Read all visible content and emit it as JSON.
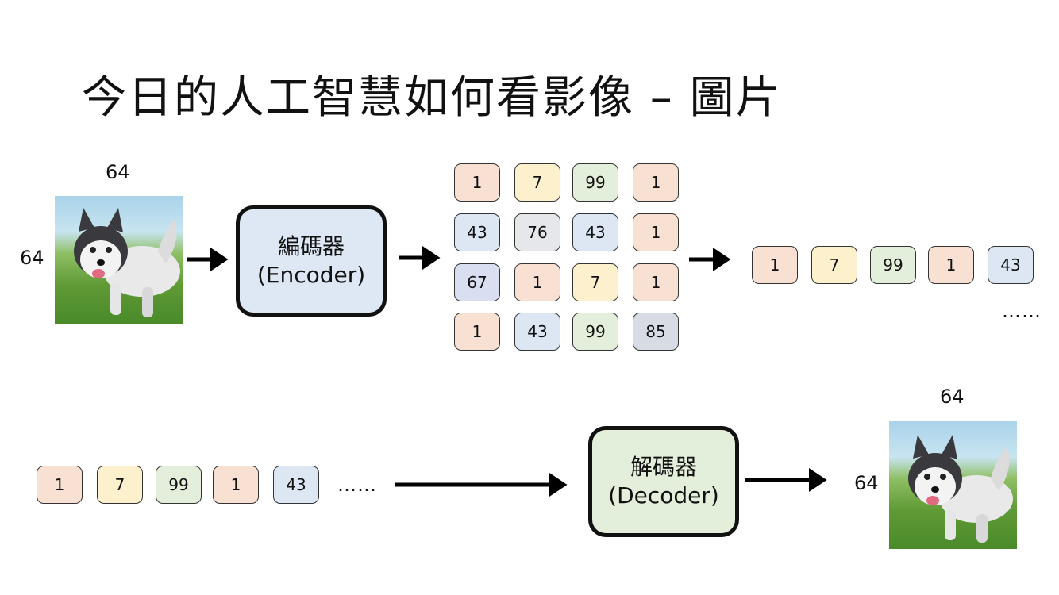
{
  "title": "今日的人工智慧如何看影像 – 圖片",
  "input_image": {
    "width_label": "64",
    "height_label": "64"
  },
  "encoder": {
    "line1": "編碼器",
    "line2": "(Encoder)"
  },
  "grid": [
    [
      {
        "v": "1",
        "c": "orange"
      },
      {
        "v": "7",
        "c": "yellow"
      },
      {
        "v": "99",
        "c": "green"
      },
      {
        "v": "1",
        "c": "orange"
      }
    ],
    [
      {
        "v": "43",
        "c": "blue"
      },
      {
        "v": "76",
        "c": "gray"
      },
      {
        "v": "43",
        "c": "blue"
      },
      {
        "v": "1",
        "c": "orange"
      }
    ],
    [
      {
        "v": "67",
        "c": "lav"
      },
      {
        "v": "1",
        "c": "orange"
      },
      {
        "v": "7",
        "c": "yellow"
      },
      {
        "v": "1",
        "c": "orange"
      }
    ],
    [
      {
        "v": "1",
        "c": "orange"
      },
      {
        "v": "43",
        "c": "blue"
      },
      {
        "v": "99",
        "c": "green"
      },
      {
        "v": "85",
        "c": "slate"
      }
    ]
  ],
  "sequence_top": [
    {
      "v": "1",
      "c": "orange"
    },
    {
      "v": "7",
      "c": "yellow"
    },
    {
      "v": "99",
      "c": "green"
    },
    {
      "v": "1",
      "c": "orange"
    },
    {
      "v": "43",
      "c": "blue"
    }
  ],
  "sequence_top_ellipsis": "……",
  "sequence_bottom": [
    {
      "v": "1",
      "c": "orange"
    },
    {
      "v": "7",
      "c": "yellow"
    },
    {
      "v": "99",
      "c": "green"
    },
    {
      "v": "1",
      "c": "orange"
    },
    {
      "v": "43",
      "c": "blue"
    }
  ],
  "sequence_bottom_ellipsis": "……",
  "decoder": {
    "line1": "解碼器",
    "line2": "(Decoder)"
  },
  "output_image": {
    "width_label": "64",
    "height_label": "64"
  }
}
